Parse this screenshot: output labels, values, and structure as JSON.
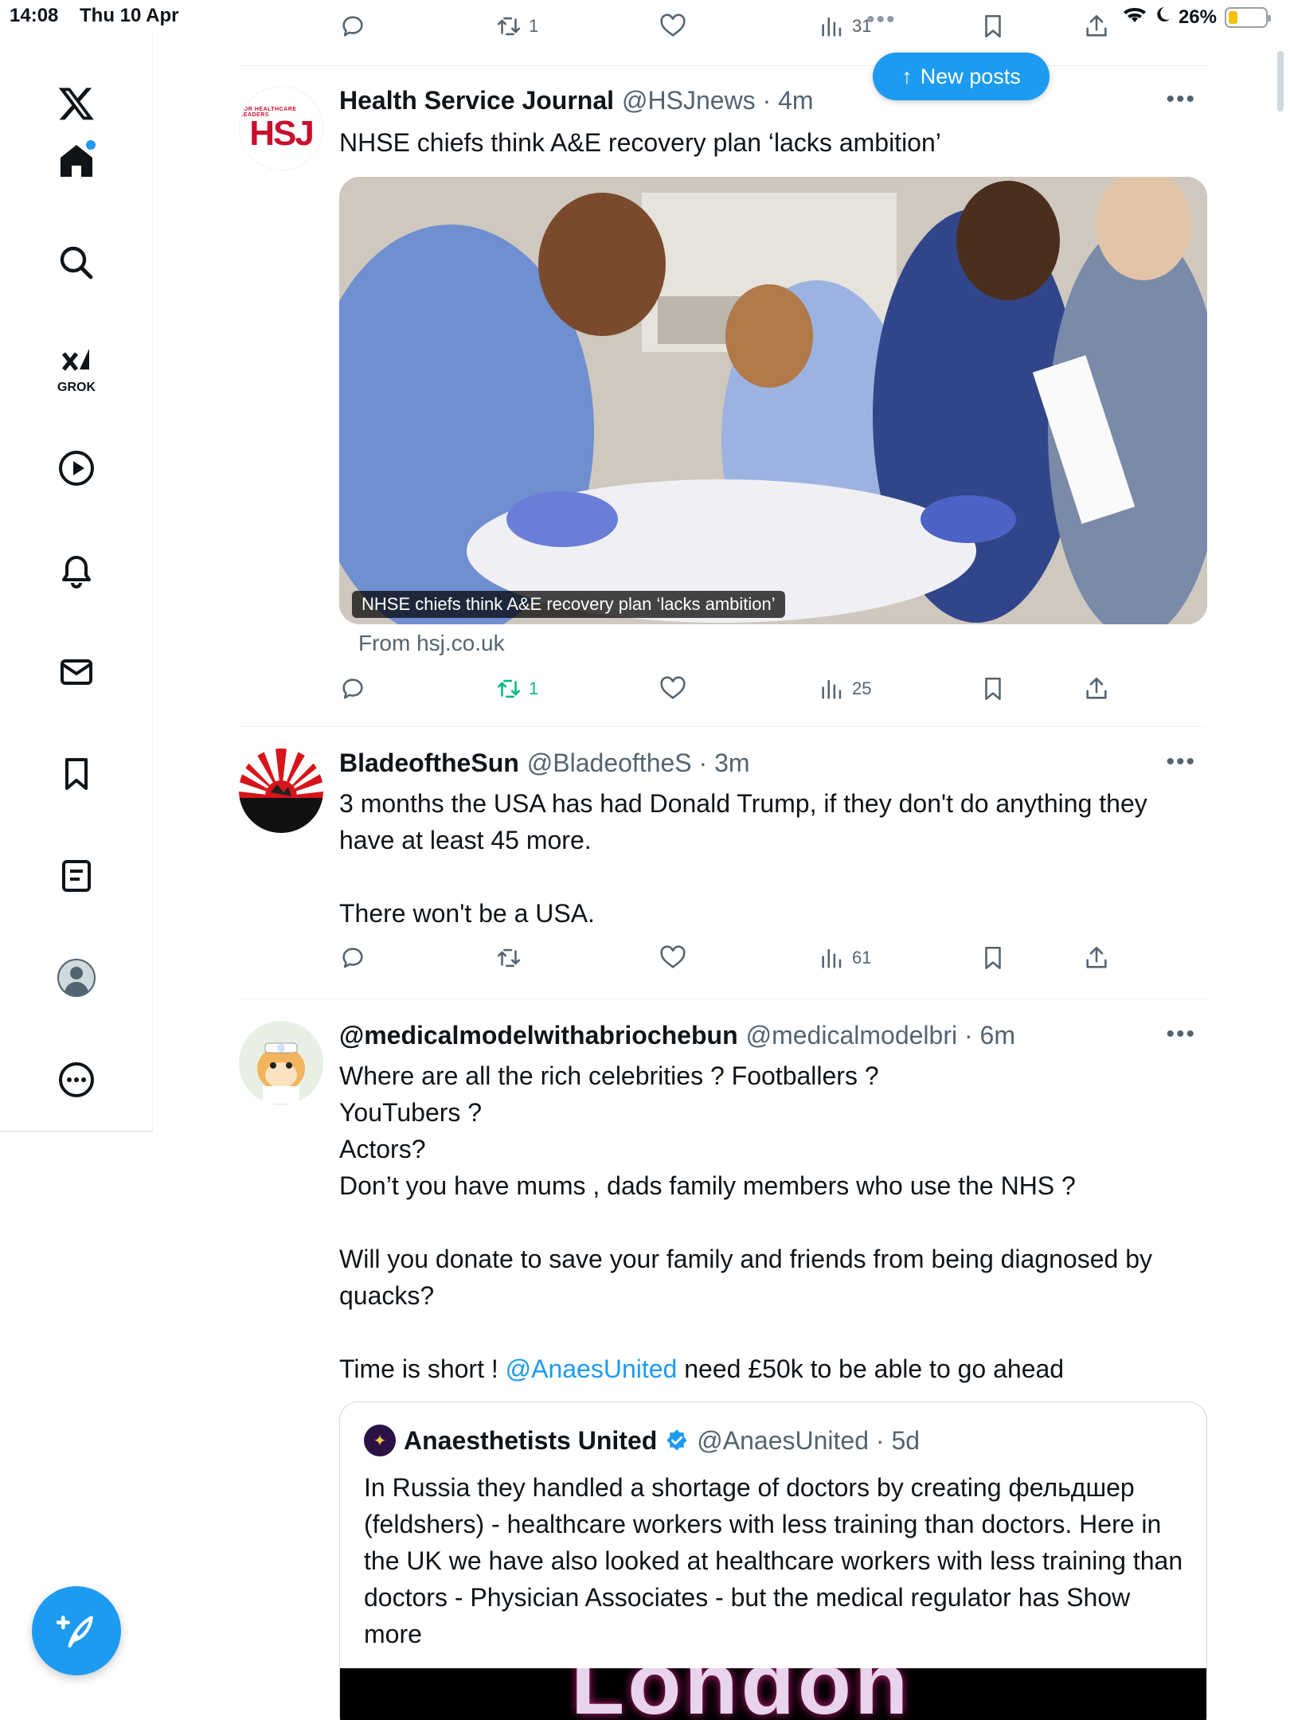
{
  "status_bar": {
    "time": "14:08",
    "date": "Thu 10 Apr",
    "battery": "26%",
    "battery_level": 0.26
  },
  "sidebar": {
    "items": [
      {
        "name": "X",
        "icon": "x-logo-icon"
      },
      {
        "name": "Home",
        "icon": "home-icon"
      },
      {
        "name": "Explore",
        "icon": "search-icon"
      },
      {
        "name": "Grok",
        "icon": "grok-icon",
        "label": "GROK"
      },
      {
        "name": "Video",
        "icon": "play-icon"
      },
      {
        "name": "Notifications",
        "icon": "bell-icon"
      },
      {
        "name": "Messages",
        "icon": "mail-icon"
      },
      {
        "name": "Bookmarks",
        "icon": "bookmark-icon"
      },
      {
        "name": "Lists",
        "icon": "list-icon"
      },
      {
        "name": "Profile",
        "icon": "avatar-icon"
      },
      {
        "name": "More",
        "icon": "more-circle-icon"
      }
    ]
  },
  "compose": {
    "icon": "compose-icon"
  },
  "new_posts": {
    "label": "New posts"
  },
  "top_actions": {
    "retweets": "1",
    "views": "31"
  },
  "posts": [
    {
      "author": "Health Service Journal",
      "handle": "@HSJnews · 4m",
      "text": "NHSE chiefs think A&E recovery plan ‘lacks ambition’",
      "avatar_text": "HSJ",
      "avatar_small": "FOR HEALTHCARE LEADERS",
      "card": {
        "title": "NHSE chiefs think A&E recovery plan ‘lacks ambition’",
        "from": "From hsj.co.uk"
      },
      "retweets": "1",
      "views": "25"
    },
    {
      "author": "BladeoftheSun",
      "handle": "@BladeoftheS · 3m",
      "text": "3 months the USA has had Donald Trump, if they don't do anything they have at least 45 more.\n\nThere won't be a USA.",
      "retweets": "",
      "views": "61"
    },
    {
      "author": "@medicalmodelwithabriochebun",
      "handle": "@medicalmodelbri · 6m",
      "text": "Where are all the rich celebrities ? Footballers ?\nYouTubers ?\nActors?\nDon’t you have mums , dads family members who use the NHS ?\n\nWill you donate to save your family and friends from being diagnosed by quacks?\n\nTime is short ! ",
      "mention": "@AnaesUnited",
      "text_after": " need £50k to be able to go ahead",
      "quote": {
        "author": "Anaesthetists United",
        "handle": "@AnaesUnited · 5d",
        "text": "In Russia they handled a shortage of doctors by creating фельдшер (feldshers) - healthcare workers with less training than doctors. Here in the UK we have also looked at healthcare workers with less training than doctors - Physician Associates - but the medical regulator has Show more",
        "image_text": "London"
      }
    }
  ]
}
